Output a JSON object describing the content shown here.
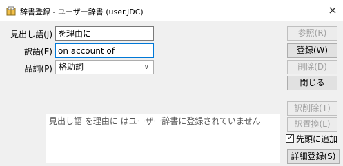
{
  "window": {
    "title": "辞書登録 - ユーザー辞書 (user.JDC)",
    "close_glyph": "×"
  },
  "form": {
    "reading_label": "見出し語(J)",
    "reading_value": "を理由に",
    "word_label": "訳語(E)",
    "word_value": "on account of",
    "pos_label": "品詞(P)",
    "pos_value": "格助詞"
  },
  "message": {
    "text": "見出し語 を理由に はユーザー辞書に登録されていません"
  },
  "buttons": {
    "ref": "参照(R)",
    "register": "登録(W)",
    "delete": "削除(D)",
    "close": "閉じる",
    "delete_word": "訳削除(T)",
    "replace_word": "訳置換(L)",
    "detail_register": "詳細登録(S)"
  },
  "options": {
    "prepend_label": "先頭に追加",
    "prepend_checked": true
  },
  "icons": {
    "app": "dictionary-book-icon",
    "dropdown": "chevron-down-icon",
    "check": "checkmark-icon"
  }
}
